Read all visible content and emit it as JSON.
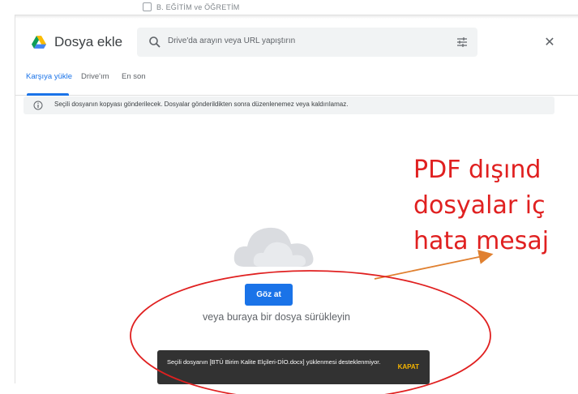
{
  "background_page": {
    "checkbox_label": "B. EĞİTİM ve ÖĞRETİM"
  },
  "dialog": {
    "title": "Dosya ekle",
    "logo_icon": "google-drive-logo",
    "search": {
      "placeholder": "Drive'da arayın veya URL yapıştırın",
      "icon": "search-icon",
      "filter_icon": "tune-icon"
    },
    "close_icon": "close-icon",
    "tabs": [
      {
        "label": "Karşıya yükle",
        "active": true
      },
      {
        "label": "Drive'ım",
        "active": false
      },
      {
        "label": "En son",
        "active": false
      }
    ],
    "notice": {
      "icon": "info-icon",
      "text": "Seçili dosyanın kopyası gönderilecek. Dosyalar gönderildikten sonra düzenlenemez veya kaldırılamaz."
    },
    "upload": {
      "illustration": "cloud-illustration",
      "browse_label": "Göz at",
      "drag_text": "veya buraya bir dosya sürükleyin"
    },
    "snackbar": {
      "message": "Seçili dosyanın [BTÜ Birim Kalite Elçileri-DİO.docx] yüklenmesi desteklenmiyor.",
      "action_label": "KAPAT"
    }
  },
  "annotation": {
    "line1": "PDF dışınd",
    "line2": "dosyalar iç",
    "line3": "hata mesaj",
    "text_color": "#e02020",
    "arrow_color": "#e08030",
    "ellipse_color": "#e02020"
  },
  "colors": {
    "accent": "#1a73e8",
    "snackbar_bg": "#323232",
    "snackbar_action": "#f4b400"
  }
}
